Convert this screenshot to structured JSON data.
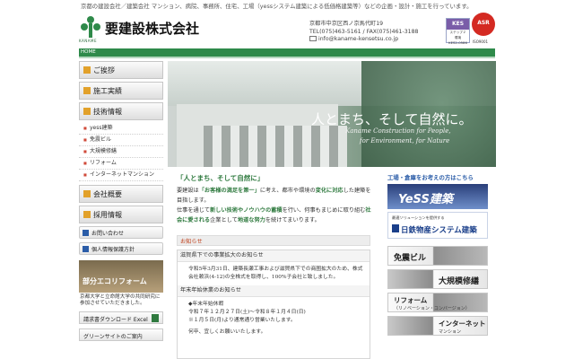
{
  "header": {
    "tagline": "京都の建設会社／建築会社 マンション、病院、事務所、住宅、工場（yessシステム建築による低価格建築等）などの企画・設計・施工を行っています。",
    "logo_sub": "KANAME",
    "company": "要建設株式会社",
    "address": "京都市中京区西ノ京馬代町19",
    "tel_fax": "TEL(075)463-5161 / FAX(075)461-3188",
    "email": "info@kaname-kensetsu.co.jp",
    "kes_mark": "KES",
    "kes_text": "ステップ２　環境",
    "kes_number": "KES2-0586",
    "asr_mark": "ASR",
    "asr_sub": "ISO9001"
  },
  "nav": {
    "home": "HOME"
  },
  "sidebar": {
    "menu": [
      {
        "label": "ご挨拶"
      },
      {
        "label": "施工実績"
      },
      {
        "label": "技術情報"
      }
    ],
    "sub_items": [
      "yess建築",
      "免震ビル",
      "大規模修繕",
      "リフォーム",
      "インターネットマンション"
    ],
    "menu2": [
      {
        "label": "会社概要"
      },
      {
        "label": "採用情報"
      }
    ],
    "inquiry": "お問い合わせ",
    "privacy": "個人情報保護方針",
    "eco_banner": "部分エコリフォーム",
    "eco_note": "京都大学と立命館大学の共同研究に参加させていただきました。",
    "download": "請求書ダウンロード Excel",
    "green_site": "グリーンサイトのご案内"
  },
  "hero": {
    "slogan": "人とまち、そして自然に。",
    "en_line1": "Kaname Construction for People,",
    "en_line2": "for Environment, for Nature"
  },
  "main": {
    "title": "「人とまち、そして自然に」",
    "p1_a": "要建設は",
    "p1_b": "「お客様の満足を第一」",
    "p1_c": "に考え、都市や環境の",
    "p1_d": "変化に対応",
    "p1_e": "した建築を目指します。",
    "p2_a": "仕事を通じて",
    "p2_b": "新しい技術やノウハウの蓄積",
    "p2_c": "を行い、何事もまじめに取り組む",
    "p2_d": "社会に愛される",
    "p2_e": "企業として",
    "p2_f": "地道な努力",
    "p2_g": "を続けてまいります。"
  },
  "news": {
    "heading": "お知らせ",
    "items": [
      {
        "title": "滋賀県下での事業拡大のお知らせ",
        "body": "令和5年3月31日、建築長瀬工事および滋賀県下での商圏拡大のため、株式会社赖浜(4-12)の全株式を取得し、100%子会社と致しました。"
      },
      {
        "title": "年末年始休業のお知らせ",
        "line1": "◆年末年始休暇",
        "line2": "令和７年１２月２７日(土)～令和８年１月４日(日)",
        "line3": "※１月５日(月)より通常通り営業いたします。",
        "line4": "何卒、宜しくお願いいたします。"
      }
    ]
  },
  "right": {
    "heading": "工場・倉庫をお考えの方はこちら",
    "banner1": "YeSS建築",
    "banner2_small": "最適ソリューションを提供する",
    "banner2_main": "日鉄物産システム建築",
    "cats": [
      {
        "label": "免震ビル"
      },
      {
        "label": "大規模修繕"
      },
      {
        "label": "リフォーム",
        "sub": "（リノベーション・コンバージョン）"
      },
      {
        "label": "インターネット",
        "sub": "マンション"
      }
    ]
  },
  "colors": {
    "green": "#2f7a3f",
    "nav_green": "#2e8a4a",
    "menu_accent": "#e2a12a",
    "news_red": "#c0431f",
    "link_blue": "#2b5da8"
  }
}
